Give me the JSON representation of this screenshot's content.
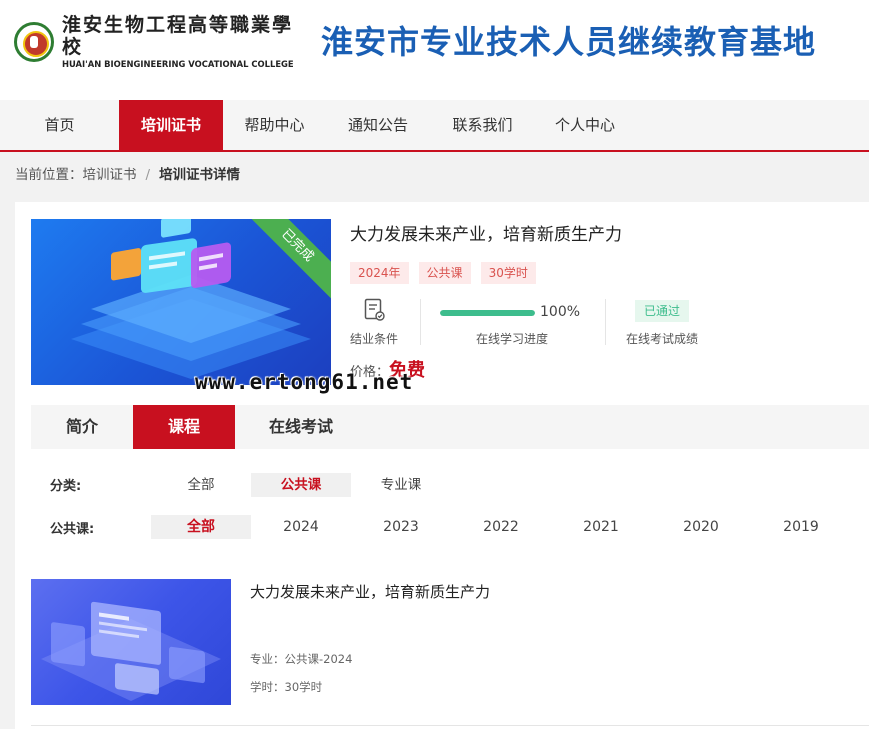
{
  "header": {
    "logo_cn": "淮安生物工程高等職業學校",
    "logo_en": "HUAI'AN BIOENGINEERING VOCATIONAL COLLEGE",
    "site_title": "淮安市专业技术人员继续教育基地"
  },
  "nav": {
    "items": [
      {
        "label": "首页"
      },
      {
        "label": "培训证书",
        "active": true
      },
      {
        "label": "帮助中心"
      },
      {
        "label": "通知公告"
      },
      {
        "label": "联系我们"
      },
      {
        "label": "个人中心"
      }
    ]
  },
  "breadcrumb": {
    "prefix": "当前位置：",
    "level1": "培训证书",
    "separator": "/",
    "current": "培训证书详情"
  },
  "course": {
    "ribbon": "已完成",
    "title": "大力发展未来产业，培育新质生产力",
    "tags": [
      "2024年",
      "公共课",
      "30学时"
    ],
    "completion_label": "结业条件",
    "progress_percent": 100,
    "progress_text": "100%",
    "progress_label": "在线学习进度",
    "exam_status": "已通过",
    "exam_label": "在线考试成绩",
    "price_label": "价格：",
    "price_value": "免费"
  },
  "tabs": [
    {
      "label": "简介"
    },
    {
      "label": "课程",
      "active": true
    },
    {
      "label": "在线考试"
    }
  ],
  "filters": {
    "category_label": "分类:",
    "category_options": [
      {
        "label": "全部"
      },
      {
        "label": "公共课",
        "active": true
      },
      {
        "label": "专业课"
      }
    ],
    "public_label": "公共课:",
    "year_options": [
      {
        "label": "全部",
        "active": true
      },
      {
        "label": "2024"
      },
      {
        "label": "2023"
      },
      {
        "label": "2022"
      },
      {
        "label": "2021"
      },
      {
        "label": "2020"
      },
      {
        "label": "2019"
      }
    ]
  },
  "list": [
    {
      "title": "大力发展未来产业，培育新质生产力",
      "major": "专业：公共课-2024",
      "hours": "学时：30学时"
    }
  ],
  "watermark": "www.ertong61.net",
  "colors": {
    "accent_red": "#c8101f",
    "title_blue": "#1a5fb4",
    "progress_green": "#3dbd8d",
    "ribbon_green": "#4caf50"
  }
}
